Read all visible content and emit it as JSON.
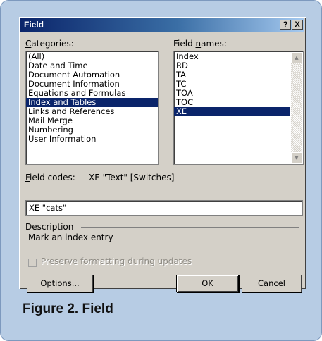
{
  "window": {
    "title": "Field",
    "help_label": "?",
    "close_label": "X"
  },
  "categories": {
    "label_pre": "",
    "label_key": "C",
    "label_post": "ategories:",
    "items": [
      "(All)",
      "Date and Time",
      "Document Automation",
      "Document Information",
      "Equations and Formulas",
      "Index and Tables",
      "Links and References",
      "Mail Merge",
      "Numbering",
      "User Information"
    ],
    "selected_index": 5
  },
  "field_names": {
    "label_pre": "Field ",
    "label_key": "n",
    "label_post": "ames:",
    "items": [
      "Index",
      "RD",
      "TA",
      "TC",
      "TOA",
      "TOC",
      "XE"
    ],
    "selected_index": 6
  },
  "field_codes": {
    "label_pre": "",
    "label_key": "F",
    "label_post": "ield codes:",
    "syntax": "XE \"Text\" [Switches]",
    "value": "XE \"cats\""
  },
  "description": {
    "heading": "Description",
    "text": "Mark an index entry"
  },
  "preserve_formatting": {
    "label": "Preserve formatting during updates",
    "checked": false,
    "enabled": false
  },
  "buttons": {
    "options_key": "O",
    "options_rest": "ptions...",
    "ok": "OK",
    "cancel": "Cancel"
  },
  "caption": "Figure 2. Field",
  "colors": {
    "frame": "#b7cce4",
    "dialog": "#d4d0c8",
    "selection": "#0a246a",
    "title_start": "#0a246a",
    "title_end": "#a6caf0"
  }
}
